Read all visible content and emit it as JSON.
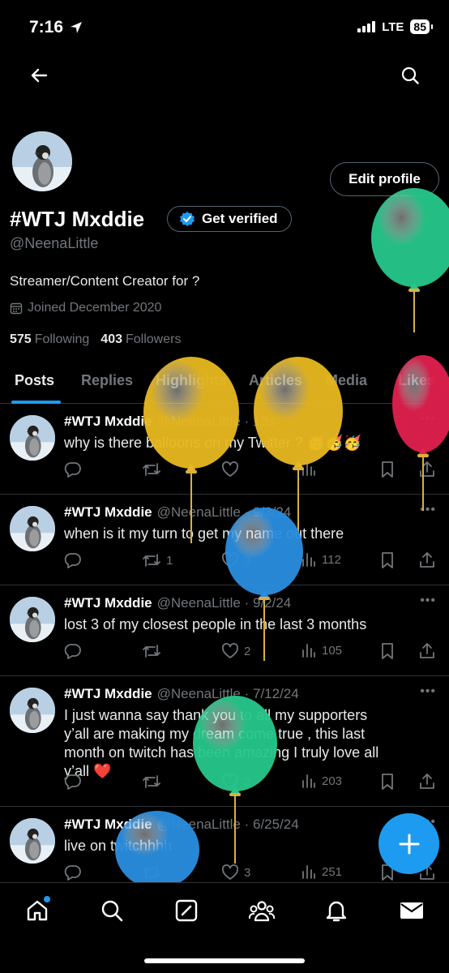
{
  "status_bar": {
    "time": "7:16",
    "network": "LTE",
    "battery": "85"
  },
  "header": {
    "back_icon": "arrow-left-icon",
    "search_icon": "search-icon"
  },
  "profile": {
    "display_name": "#WTJ Mxddie",
    "verify_label": "Get verified",
    "edit_label": "Edit profile",
    "handle": "@NeenaLittle",
    "bio": "Streamer/Content Creator for ?",
    "joined": "Joined December 2020",
    "following_count": "575",
    "following_label": "Following",
    "followers_count": "403",
    "followers_label": "Followers"
  },
  "tabs": [
    {
      "label": "Posts",
      "active": true
    },
    {
      "label": "Replies",
      "active": false
    },
    {
      "label": "Highlights",
      "active": false
    },
    {
      "label": "Articles",
      "active": false
    },
    {
      "label": "Media",
      "active": false
    },
    {
      "label": "Likes",
      "active": false
    }
  ],
  "tweets": [
    {
      "name": "#WTJ Mxddie",
      "meta": "@NeenaLittle · 13s",
      "text": "why is there balloons on my Twitter ? 🥳🥳🥳",
      "retweets": "",
      "likes": "",
      "views": ""
    },
    {
      "name": "#WTJ Mxddie",
      "meta": "@NeenaLittle · 9/3/24",
      "text": "when is it my turn to get my name out there",
      "retweets": "1",
      "likes": "3",
      "views": "112"
    },
    {
      "name": "#WTJ Mxddie",
      "meta": "@NeenaLittle · 9/2/24",
      "text": "lost 3 of my closest people in the last 3 months",
      "retweets": "",
      "likes": "2",
      "views": "105"
    },
    {
      "name": "#WTJ Mxddie",
      "meta": "@NeenaLittle · 7/12/24",
      "text": "I just wanna say thank you to all my supporters y’all are making my dream come true , this last month on twitch has been amazing I truly love all y’all ❤️",
      "retweets": "",
      "likes": "2",
      "views": "203"
    },
    {
      "name": "#WTJ Mxddie",
      "meta": "@NeenaLittle · 6/25/24",
      "text": "live on twitchhhh",
      "retweets": "",
      "likes": "3",
      "views": "251"
    }
  ],
  "more_glyph": "•••",
  "fab_icon": "plus-icon",
  "bottom_nav": [
    "home-icon",
    "search-icon",
    "grok-icon",
    "communities-icon",
    "notifications-icon",
    "messages-icon"
  ],
  "colors": {
    "accent": "#1d9bf0",
    "background": "#000000",
    "muted": "#71767b",
    "border": "#2f3336"
  },
  "balloon_colors": [
    "#26c88b",
    "#e8b820",
    "#e8b820",
    "#e0204d",
    "#2a8ee0",
    "#26c88b",
    "#2a8ee0"
  ]
}
